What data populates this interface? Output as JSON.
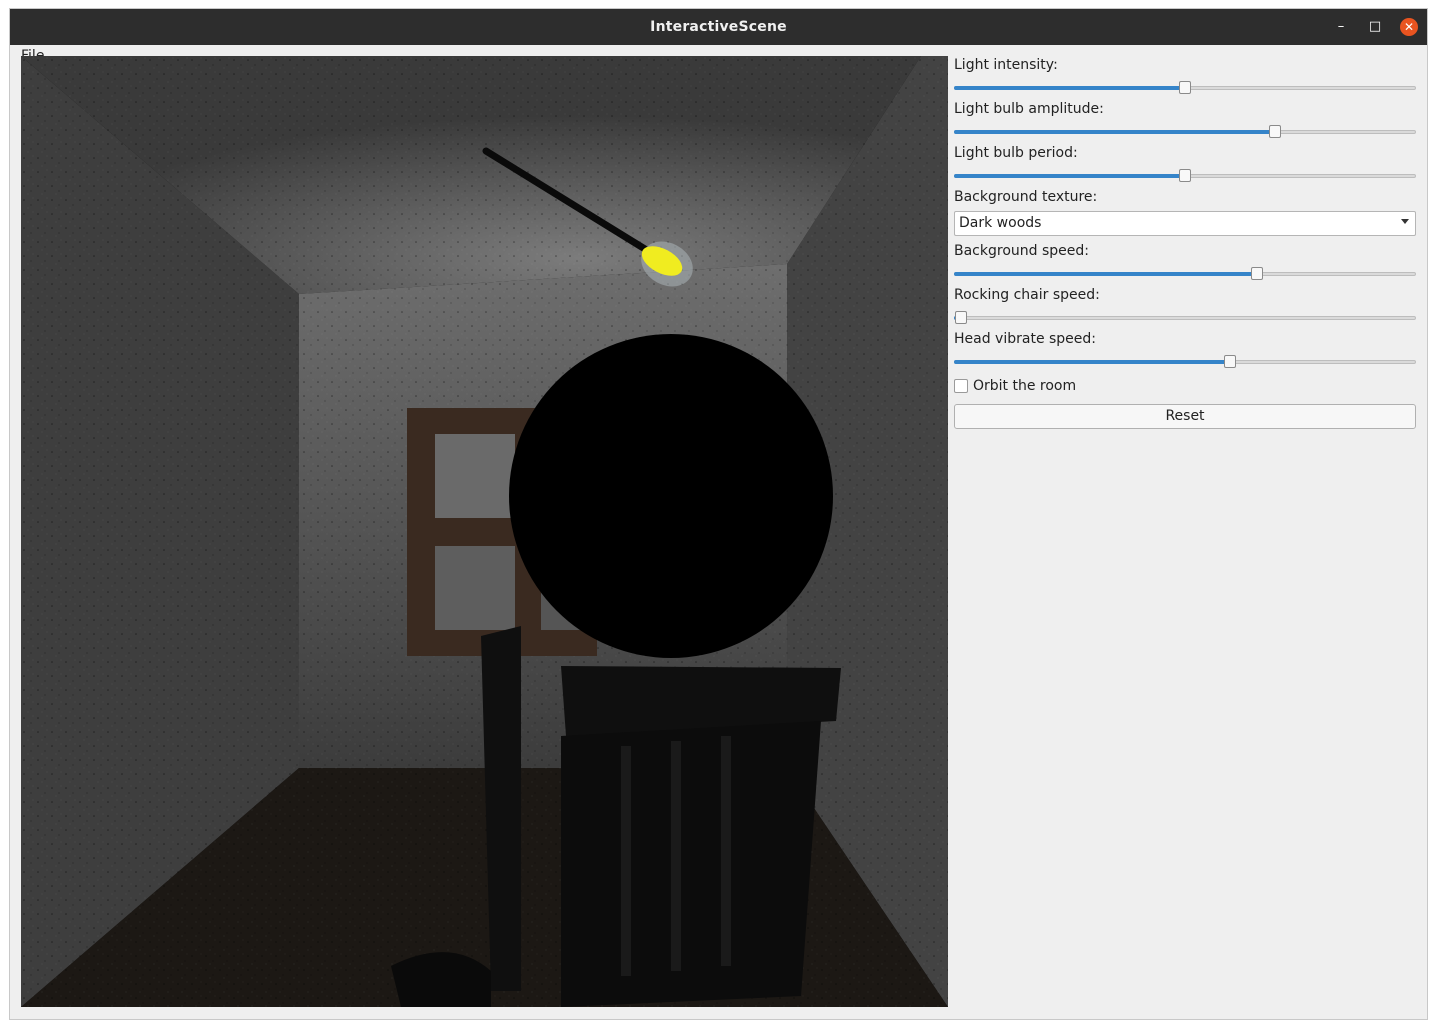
{
  "window": {
    "title": "InteractiveScene",
    "minimize_glyph": "–",
    "maximize_glyph": "□",
    "close_glyph": "✕",
    "close_color": "#e95420"
  },
  "menubar": {
    "file": "File"
  },
  "controls": {
    "accent_color": "#3584c9",
    "light_intensity": {
      "label": "Light intensity:",
      "value": 0.5
    },
    "bulb_amplitude": {
      "label": "Light bulb amplitude:",
      "value": 0.7
    },
    "bulb_period": {
      "label": "Light bulb period:",
      "value": 0.5
    },
    "background_texture": {
      "label": "Background texture:",
      "selected": "Dark woods"
    },
    "background_speed": {
      "label": "Background speed:",
      "value": 0.66
    },
    "rocking_chair_speed": {
      "label": "Rocking chair speed:",
      "value": 0.0
    },
    "head_vibrate_speed": {
      "label": "Head vibrate speed:",
      "value": 0.6
    },
    "orbit": {
      "label": "Orbit the room",
      "checked": false
    },
    "reset_label": "Reset"
  }
}
